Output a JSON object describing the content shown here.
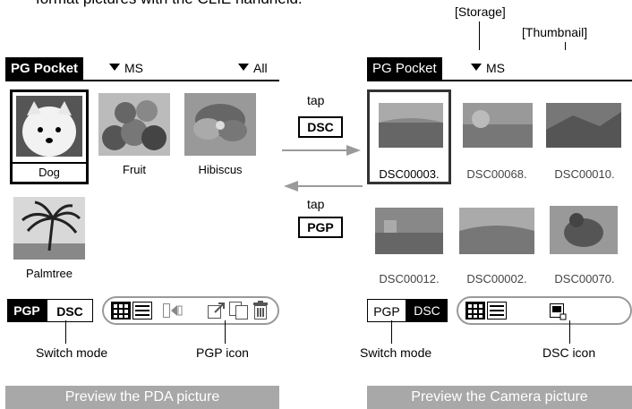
{
  "intro_text": "format pictures with the CLIE handheld.",
  "callouts": {
    "storage": "[Storage]",
    "thumbnail": "[Thumbnail]",
    "switch_mode_left": "Switch mode",
    "pgp_icon": "PGP icon",
    "switch_mode_right": "Switch mode",
    "dsc_icon": "DSC icon"
  },
  "arrows": {
    "to_camera_tap": "tap",
    "to_camera_button": "DSC",
    "to_pda_tap": "tap",
    "to_pda_button": "PGP"
  },
  "left_screen": {
    "app_title": "PG Pocket",
    "storage": "MS",
    "filter": "All",
    "items": [
      {
        "label": "Dog",
        "selected": true
      },
      {
        "label": "Fruit",
        "selected": false
      },
      {
        "label": "Hibiscus",
        "selected": false
      },
      {
        "label": "Palmtree",
        "selected": false
      }
    ],
    "mode_pgp": "PGP",
    "mode_dsc": "DSC"
  },
  "right_screen": {
    "app_title": "PG Pocket",
    "storage": "MS",
    "items": [
      {
        "label": "DSC00003.",
        "selected": true
      },
      {
        "label": "DSC00068.",
        "selected": false
      },
      {
        "label": "DSC00010.",
        "selected": false
      },
      {
        "label": "DSC00012.",
        "selected": false
      },
      {
        "label": "DSC00002.",
        "selected": false
      },
      {
        "label": "DSC00070.",
        "selected": false
      }
    ],
    "mode_pgp": "PGP",
    "mode_dsc": "DSC"
  },
  "banners": {
    "left": "Preview the PDA picture",
    "right": "Preview the Camera picture"
  },
  "colors": {
    "banner": "#a8a8a8",
    "arrow": "#9a9a9a",
    "icon_outline": "#9a9a9a"
  }
}
